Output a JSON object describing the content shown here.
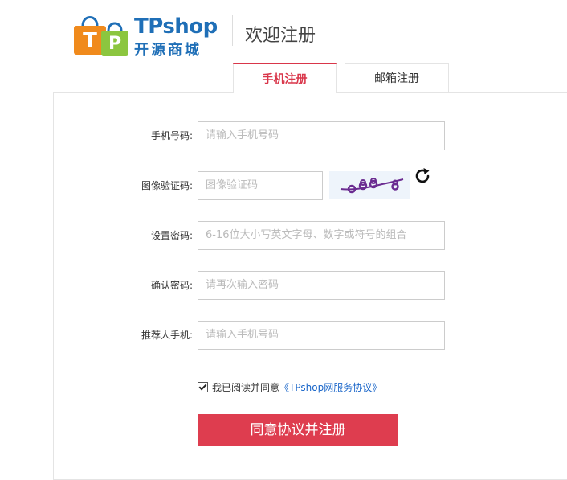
{
  "header": {
    "logo_en": "TPshop",
    "logo_cn": "开源商城",
    "bag1_letter": "T",
    "bag2_letter": "P",
    "welcome": "欢迎注册"
  },
  "tabs": [
    {
      "label": "手机注册",
      "active": true
    },
    {
      "label": "邮箱注册",
      "active": false
    }
  ],
  "form": {
    "phone": {
      "label": "手机号码:",
      "placeholder": "请输入手机号码"
    },
    "captcha": {
      "label": "图像验证码:",
      "placeholder": "图像验证码"
    },
    "password": {
      "label": "设置密码:",
      "placeholder": "6-16位大小写英文字母、数字或符号的组合"
    },
    "confirm": {
      "label": "确认密码:",
      "placeholder": "请再次输入密码"
    },
    "referrer": {
      "label": "推荐人手机:",
      "placeholder": "请输入手机号码"
    }
  },
  "agreement": {
    "checked": true,
    "text": "我已阅读并同意",
    "link": "《TPshop网服务协议》"
  },
  "submit_label": "同意协议并注册",
  "colors": {
    "accent": "#de3d4f",
    "logo_blue": "#1f6fb7",
    "link": "#1a66c9",
    "bag_orange": "#f08a1c",
    "bag_green": "#8cc63f"
  },
  "icons": {
    "refresh": "refresh-icon",
    "captcha": "captcha-image"
  }
}
